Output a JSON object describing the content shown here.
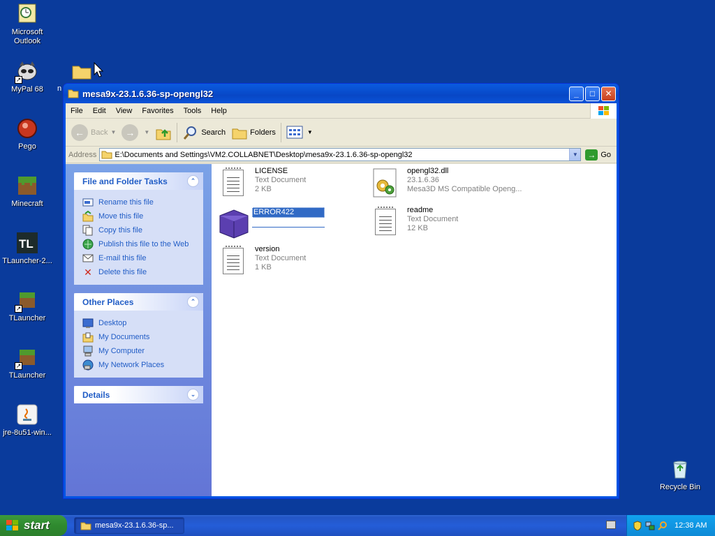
{
  "desktop": {
    "icons": [
      {
        "label": "Microsoft\nOutlook",
        "icon": "outlook-icon"
      },
      {
        "label": "MyPal 68",
        "icon": "mypal-icon"
      },
      {
        "label": "Pego",
        "icon": "pego-icon"
      },
      {
        "label": "Minecraft",
        "icon": "minecraft-icon"
      },
      {
        "label": "TLauncher-2...",
        "icon": "tlauncher-logo-icon"
      },
      {
        "label": "TLauncher",
        "icon": "tlauncher-icon"
      },
      {
        "label": "TLauncher",
        "icon": "tlauncher-icon"
      },
      {
        "label": "jre-8u51-win...",
        "icon": "java-icon"
      }
    ],
    "recycle_bin": {
      "label": "Recycle Bin",
      "icon": "recycle-bin-icon"
    },
    "partial_label": "n"
  },
  "window": {
    "title": "mesa9x-23.1.6.36-sp-opengl32",
    "menu": [
      "File",
      "Edit",
      "View",
      "Favorites",
      "Tools",
      "Help"
    ],
    "toolbar": {
      "back": "Back",
      "search": "Search",
      "folders": "Folders"
    },
    "address": {
      "label": "Address",
      "value": "E:\\Documents and Settings\\VM2.COLLABNET\\Desktop\\mesa9x-23.1.6.36-sp-opengl32",
      "go": "Go"
    },
    "file_tasks": {
      "title": "File and Folder Tasks",
      "items": [
        {
          "label": "Rename this file",
          "icon": "rename-icon"
        },
        {
          "label": "Move this file",
          "icon": "move-icon"
        },
        {
          "label": "Copy this file",
          "icon": "copy-icon"
        },
        {
          "label": "Publish this file to the Web",
          "icon": "publish-icon"
        },
        {
          "label": "E-mail this file",
          "icon": "email-icon"
        },
        {
          "label": "Delete this file",
          "icon": "delete-icon"
        }
      ]
    },
    "other_places": {
      "title": "Other Places",
      "items": [
        {
          "label": "Desktop",
          "icon": "desktop-icon"
        },
        {
          "label": "My Documents",
          "icon": "my-documents-icon"
        },
        {
          "label": "My Computer",
          "icon": "my-computer-icon"
        },
        {
          "label": "My Network Places",
          "icon": "network-places-icon"
        }
      ]
    },
    "details": {
      "title": "Details"
    },
    "files": [
      {
        "name": "LICENSE",
        "type": "Text Document",
        "size": "2 KB",
        "icon": "text-document-icon"
      },
      {
        "name": "opengl32.dll",
        "type": "23.1.6.36",
        "size": "Mesa3D MS Compatible Openg...",
        "icon": "dll-icon"
      },
      {
        "name": "ERROR422",
        "type": "",
        "size": "",
        "icon": "cube-file-icon"
      },
      {
        "name": "readme",
        "type": "Text Document",
        "size": "12 KB",
        "icon": "text-document-icon"
      },
      {
        "name": "version",
        "type": "Text Document",
        "size": "1 KB",
        "icon": "text-document-icon"
      }
    ]
  },
  "taskbar": {
    "start": "start",
    "app_button": "mesa9x-23.1.6.36-sp...",
    "clock": "12:38 AM"
  }
}
